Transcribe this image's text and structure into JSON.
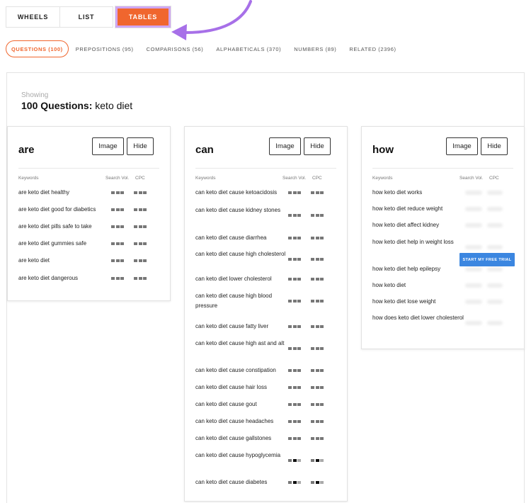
{
  "view_tabs": {
    "wheels": "WHEELS",
    "list": "LIST",
    "tables": "TABLES"
  },
  "filters": [
    "QUESTIONS (100)",
    "PREPOSITIONS (95)",
    "COMPARISONS (56)",
    "ALPHABETICALS (370)",
    "NUMBERS (89)",
    "RELATED (2396)"
  ],
  "showing": {
    "label": "Showing",
    "count_text": "100 Questions:",
    "query": "keto diet"
  },
  "columns": {
    "keywords": "Keywords",
    "search_vol": "Search Vol.",
    "cpc": "CPC"
  },
  "buttons": {
    "image": "Image",
    "hide": "Hide",
    "trial": "START MY FREE TRIAL"
  },
  "colors": {
    "accent": "#f0662e",
    "highlight": "#cfa6f2",
    "trial": "#3b86e0"
  },
  "cards": {
    "are": {
      "title": "are",
      "rows": [
        "are keto diet healthy",
        "are keto diet good for diabetics",
        "are keto diet pills safe to take",
        "are keto diet gummies safe",
        "are keto diet",
        "are keto diet dangerous"
      ]
    },
    "can": {
      "title": "can",
      "rows": [
        "can keto diet cause ketoacidosis",
        "can keto diet cause kidney stones",
        "can keto diet cause diarrhea",
        "can keto diet cause high cholesterol",
        "can keto diet lower cholesterol",
        "can keto diet cause high blood pressure",
        "can keto diet cause fatty liver",
        "can keto diet cause high ast and alt",
        "can keto diet cause constipation",
        "can keto diet cause hair loss",
        "can keto diet cause gout",
        "can keto diet cause headaches",
        "can keto diet cause gallstones",
        "can keto diet cause hypoglycemia",
        "can keto diet cause diabetes"
      ]
    },
    "how": {
      "title": "how",
      "rows": [
        "how keto diet works",
        "how keto diet reduce weight",
        "how keto diet affect kidney",
        "how keto diet help in weight loss",
        "how keto diet help epilepsy",
        "how keto diet",
        "how keto diet lose weight",
        "how does keto diet lower cholesterol"
      ]
    }
  }
}
